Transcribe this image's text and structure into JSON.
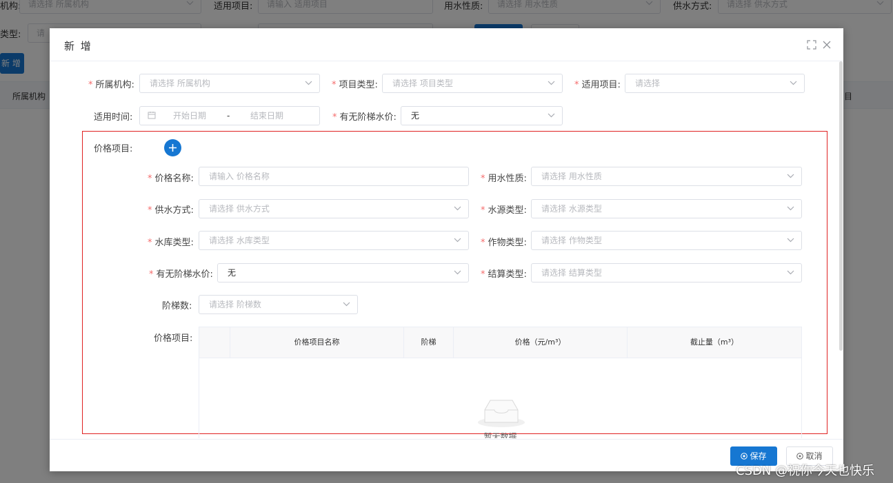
{
  "background": {
    "filters": [
      {
        "label": "机构:",
        "placeholder": "请选择 所属机构"
      },
      {
        "label": "适用项目:",
        "placeholder": "请输入 适用项目"
      },
      {
        "label": "用水性质:",
        "placeholder": "请选择 用水性质"
      },
      {
        "label": "供水方式:",
        "placeholder": "请选择 供水方式"
      }
    ],
    "row2_label": "类型:",
    "row2_placeholder": "请",
    "add_button": "新 增",
    "table_headers": [
      "所属机构",
      "目"
    ]
  },
  "dialog": {
    "title": "新 增",
    "form": {
      "org": {
        "label": "所属机构:",
        "placeholder": "请选择 所属机构"
      },
      "project_type": {
        "label": "项目类型:",
        "placeholder": "请选择 项目类型"
      },
      "applicable_project": {
        "label": "适用项目:",
        "placeholder": "请选择"
      },
      "applicable_time": {
        "label": "适用时间:",
        "start_placeholder": "开始日期",
        "separator": "-",
        "end_placeholder": "结束日期"
      },
      "tiered_price": {
        "label": "有无阶梯水价:",
        "value": "无"
      }
    },
    "price_section": {
      "label": "价格项目:",
      "add_icon": "plus-icon",
      "price_name": {
        "label": "价格名称:",
        "placeholder": "请输入 价格名称"
      },
      "water_nature": {
        "label": "用水性质:",
        "placeholder": "请选择 用水性质"
      },
      "supply_mode": {
        "label": "供水方式:",
        "placeholder": "请选择 供水方式"
      },
      "water_source": {
        "label": "水源类型:",
        "placeholder": "请选择 水源类型"
      },
      "reservoir": {
        "label": "水库类型:",
        "placeholder": "请选择 水库类型"
      },
      "crop": {
        "label": "作物类型:",
        "placeholder": "请选择 作物类型"
      },
      "tiered": {
        "label": "有无阶梯水价:",
        "value": "无"
      },
      "settlement": {
        "label": "结算类型:",
        "placeholder": "请选择 结算类型"
      },
      "tier_count": {
        "label": "阶梯数:",
        "placeholder": "请选择 阶梯数"
      },
      "table_label": "价格项目:",
      "table_headers": [
        "",
        "价格项目名称",
        "阶梯",
        "价格（元/m³）",
        "截止量（m³）"
      ],
      "empty_text": "暂无数据"
    },
    "footer": {
      "save": "保存",
      "cancel": "取消"
    }
  },
  "watermark": "CSDN @祝你今天也快乐",
  "colors": {
    "primary": "#1677d2",
    "required": "#f56c6c",
    "highlight_border": "#e02020"
  }
}
